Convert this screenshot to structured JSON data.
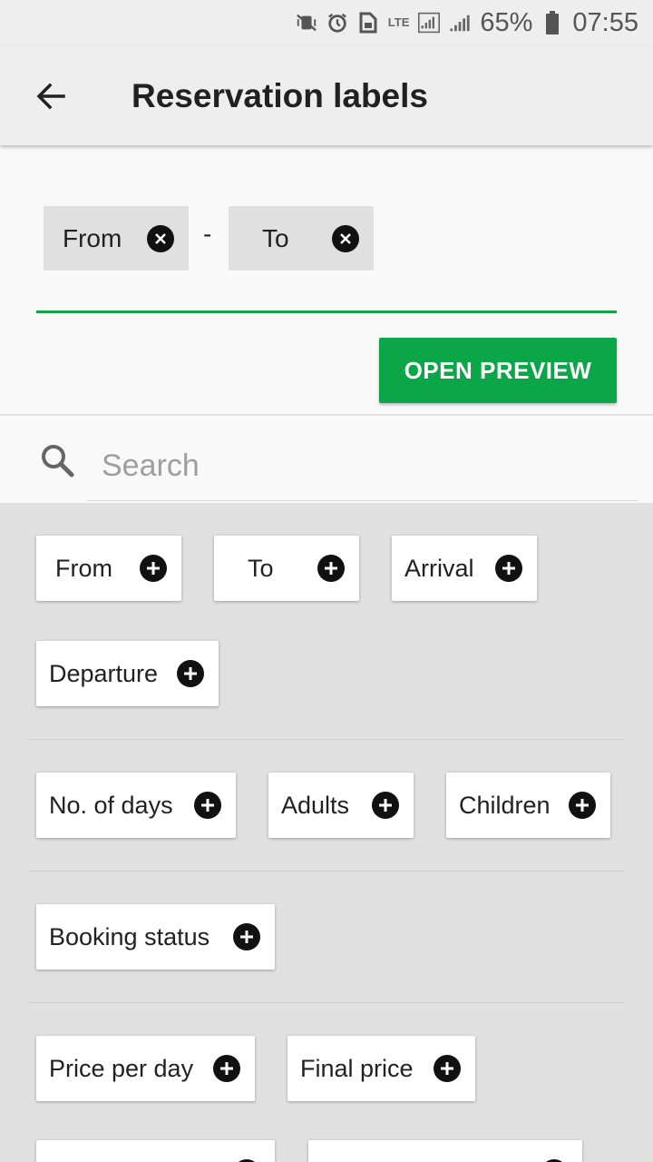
{
  "status_bar": {
    "lte": "LTE",
    "battery": "65%",
    "time": "07:55",
    "icons": [
      "vibrate-off-icon",
      "alarm-icon",
      "sim-icon",
      "lte-icon",
      "signal-icon",
      "signal-icon",
      "battery-icon"
    ]
  },
  "app_bar": {
    "title": "Reservation labels",
    "back_icon": "arrow-left-icon"
  },
  "selected": {
    "chips": [
      "From",
      "To"
    ],
    "separator": "-"
  },
  "preview_button": "OPEN PREVIEW",
  "search": {
    "placeholder": "Search",
    "value": ""
  },
  "label_groups": [
    {
      "items": [
        "From",
        "To",
        "Arrival",
        "Departure"
      ]
    },
    {
      "items": [
        "No. of days",
        "Adults",
        "Children"
      ]
    },
    {
      "items": [
        "Booking status"
      ]
    },
    {
      "items": [
        "Price per day",
        "Final price"
      ]
    }
  ],
  "colors": {
    "accent": "#0ba648",
    "underline": "#1aa14a",
    "background": "#e0e0e0",
    "panel": "#f9f9f9"
  }
}
